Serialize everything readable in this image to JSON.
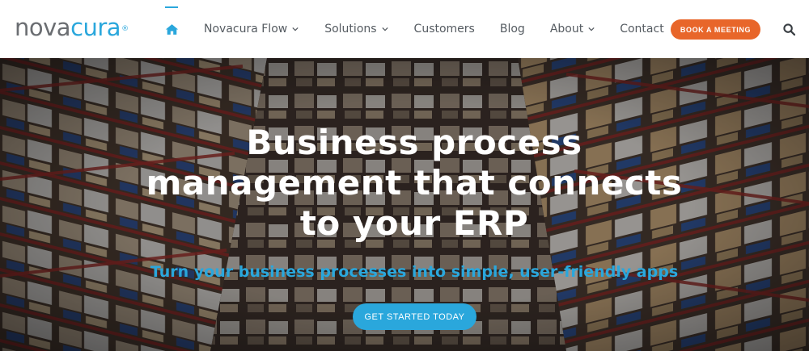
{
  "brand": {
    "logo_part1": "nova",
    "logo_part2": "cura",
    "logo_mark": "®"
  },
  "nav": {
    "home_icon": "home-icon",
    "items": [
      {
        "label": "Novacura Flow",
        "has_dropdown": true
      },
      {
        "label": "Solutions",
        "has_dropdown": true
      },
      {
        "label": "Customers",
        "has_dropdown": false
      },
      {
        "label": "Blog",
        "has_dropdown": false
      },
      {
        "label": "About",
        "has_dropdown": true
      },
      {
        "label": "Contact",
        "has_dropdown": false
      }
    ],
    "cta_label": "BOOK A MEETING",
    "search_icon": "search-icon"
  },
  "hero": {
    "title": "Business process management that connects to your ERP",
    "subtitle": "Turn your business processes into simple, user-friendly apps",
    "cta_label": "GET STARTED TODAY",
    "background": "warehouse-shelves-photo"
  },
  "colors": {
    "accent_blue": "#2aa7dc",
    "cta_orange": "#e8662a",
    "nav_text": "#555b61",
    "logo_gray": "#6b6e72"
  }
}
